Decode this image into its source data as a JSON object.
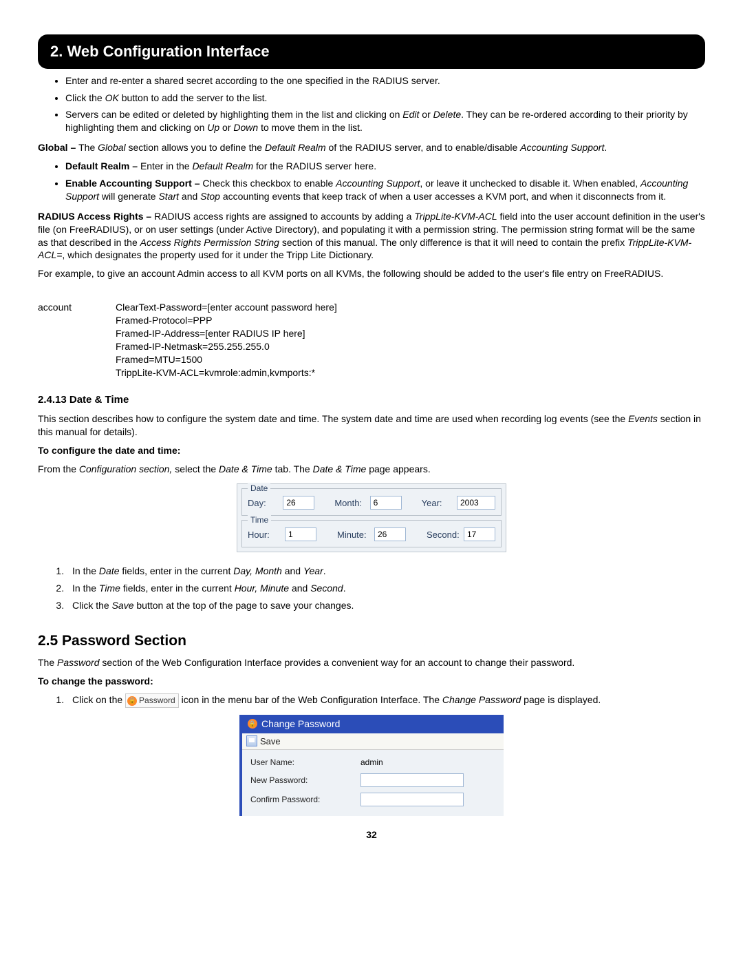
{
  "header": {
    "title": "2. Web Configuration Interface"
  },
  "intro_bullets": [
    "Enter and re-enter a shared secret according to the one specified in the RADIUS server.",
    "Click the OK button to add the server to the list.",
    "Servers can be edited or deleted by highlighting them in the list and clicking on Edit or Delete. They can be re-ordered according to their priority by highlighting them and clicking on Up or Down to move them in the list."
  ],
  "global": {
    "lead_bold": "Global – ",
    "lead_text": "The Global section allows you to define the Default Realm of the RADIUS server, and to enable/disable Accounting Support.",
    "items": [
      {
        "label": "Default Realm – ",
        "text": "Enter in the Default Realm for the RADIUS server here."
      },
      {
        "label": "Enable Accounting Support – ",
        "text": "Check this checkbox to enable Accounting Support, or leave it unchecked to disable it. When enabled, Accounting Support will generate Start and Stop accounting events that keep track of when a user accesses a KVM port, and when it disconnects from it."
      }
    ]
  },
  "radius": {
    "lead_bold": "RADIUS Access Rights – ",
    "para1": "RADIUS access rights are assigned to accounts by adding a TrippLite-KVM-ACL field into the user account definition in the user's file (on FreeRADIUS), or on user settings (under Active Directory), and populating it with a permission string. The permission string format will be the same as that described in the Access Rights Permission String section of this manual. The only difference is that it will need to contain the prefix TrippLite-KVM-ACL=, which designates the property used for it under the Tripp Lite Dictionary.",
    "para2": "For example, to give an account Admin access to all KVM ports on all KVMs, the following should be added to the user's file entry on FreeRADIUS."
  },
  "code": {
    "label": "account",
    "lines": [
      "ClearText-Password=[enter account password here]",
      "Framed-Protocol=PPP",
      "Framed-IP-Address=[enter RADIUS IP here]",
      "Framed-IP-Netmask=255.255.255.0",
      "Framed=MTU=1500",
      "TrippLite-KVM-ACL=kvmrole:admin,kvmports:*"
    ]
  },
  "datetime": {
    "heading": "2.4.13 Date & Time",
    "para": "This section describes how to configure the system date and time. The system date and time are used when recording log events (see the Events section in this manual for details).",
    "configure_heading": "To configure the date and time:",
    "configure_lead": "From the Configuration section, select the Date & Time tab. The Date & Time page appears.",
    "ui": {
      "date_legend": "Date",
      "time_legend": "Time",
      "day_label": "Day:",
      "day_value": "26",
      "month_label": "Month:",
      "month_value": "6",
      "year_label": "Year:",
      "year_value": "2003",
      "hour_label": "Hour:",
      "hour_value": "1",
      "minute_label": "Minute:",
      "minute_value": "26",
      "second_label": "Second:",
      "second_value": "17"
    },
    "steps": [
      "In the Date fields, enter in the current Day, Month and Year.",
      "In the Time fields, enter in the current Hour, Minute and Second.",
      "Click the Save button at the top of the page to save your changes."
    ]
  },
  "password": {
    "heading": "2.5 Password Section",
    "para": "The Password section of the Web Configuration Interface provides a convenient way for an account to change their password.",
    "change_heading": "To change the password:",
    "step1_pre": "Click on the ",
    "icon_label": "Password",
    "step1_post": " icon in the menu bar of the Web Configuration Interface. The Change Password page is displayed.",
    "ui": {
      "title": "Change Password",
      "save": "Save",
      "username_label": "User Name:",
      "username_value": "admin",
      "newpass_label": "New Password:",
      "confirmpass_label": "Confirm Password:"
    }
  },
  "page_number": "32"
}
